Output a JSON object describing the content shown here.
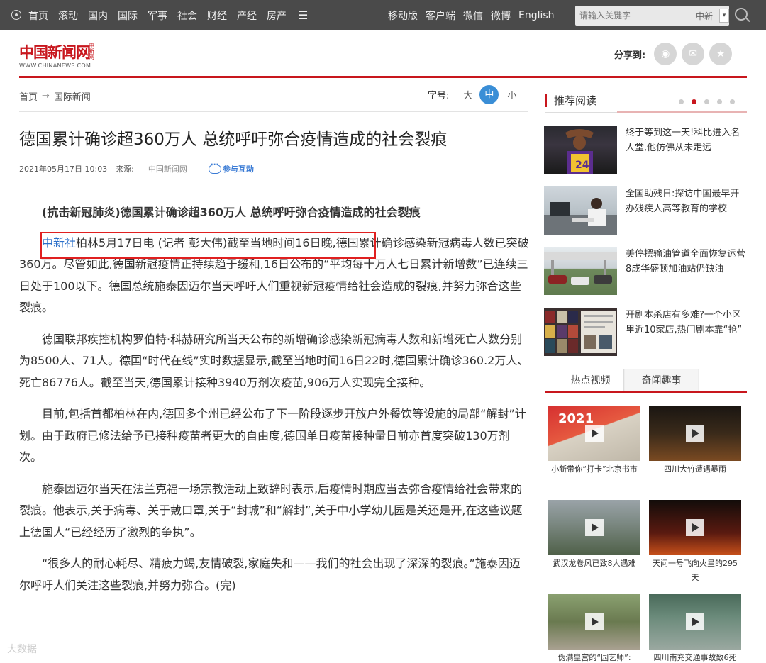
{
  "topnav": {
    "left_items": [
      "首页",
      "滚动",
      "国内",
      "国际",
      "军事",
      "社会",
      "财经",
      "产经",
      "房产"
    ],
    "menu_glyph": "☰",
    "right_items": [
      "移动版",
      "客户端",
      "微信",
      "微博",
      "English"
    ],
    "search_placeholder": "请输入关键字",
    "search_scope": "中新",
    "dropdown_glyph": "▾"
  },
  "logo": {
    "cn": "中国新闻网",
    "small": "中新网",
    "en": "WWW.CHINANEWS.COM"
  },
  "share": {
    "label": "分享到:",
    "glyphs": [
      "◉",
      "✉",
      "★"
    ]
  },
  "breadcrumb": {
    "home": "首页",
    "sep": "→",
    "section": "国际新闻"
  },
  "fontsize": {
    "label": "字号:",
    "large": "大",
    "medium": "中",
    "small": "小"
  },
  "article": {
    "title": "德国累计确诊超360万人 总统呼吁弥合疫情造成的社会裂痕",
    "date": "2021年05月17日 10:03",
    "source_label": "来源:",
    "source": "中国新闻网",
    "interact": "参与互动",
    "lead": "(抗击新冠肺炎)德国累计确诊超360万人 总统呼吁弥合疫情造成的社会裂痕",
    "p1_agency": "中新社",
    "p1_highlight": "柏林5月17日电 (记者 彭大伟)截至当地时间16日晚,",
    "p1_rest": "德国累计确诊感染新冠病毒人数已突破360万。尽管如此,德国新冠疫情正持续趋于缓和,16日公布的“平均每十万人七日累计新增数”已连续三日处于100以下。德国总统施泰因迈尔当天呼吁人们重视新冠疫情给社会造成的裂痕,并努力弥合这些裂痕。",
    "p2": "德国联邦疾控机构罗伯特·科赫研究所当天公布的新增确诊感染新冠病毒人数和新增死亡人数分别为8500人、71人。德国“时代在线”实时数据显示,截至当地时间16日22时,德国累计确诊360.2万人、死亡86776人。截至当天,德国累计接种3940万剂次疫苗,906万人实现完全接种。",
    "p3": "目前,包括首都柏林在内,德国多个州已经公布了下一阶段逐步开放户外餐饮等设施的局部“解封”计划。由于政府已修法给予已接种疫苗者更大的自由度,德国单日疫苗接种量日前亦首度突破130万剂次。",
    "p4": "施泰因迈尔当天在法兰克福一场宗教活动上致辞时表示,后疫情时期应当去弥合疫情给社会带来的裂痕。他表示,关于病毒、关于戴口罩,关于“封城”和“解封”,关于中小学幼儿园是关还是开,在这些议题上德国人“已经经历了激烈的争执”。",
    "p5": "“很多人的耐心耗尽、精疲力竭,友情破裂,家庭失和——我们的社会出现了深深的裂痕。”施泰因迈尔呼吁人们关注这些裂痕,并努力弥合。(完)"
  },
  "watermark": "大数据",
  "recommend": {
    "title": "推荐阅读",
    "items": [
      {
        "text": "终于等到这一天!科比进入名人堂,他仿佛从未走远"
      },
      {
        "text": "全国助残日:探访中国最早开办残疾人高等教育的学校"
      },
      {
        "text": "美停摆输油管道全面恢复运营 8成华盛顿加油站仍缺油"
      },
      {
        "text": "开剧本杀店有多难?一个小区里近10家店,热门剧本靠“抢”"
      }
    ]
  },
  "tabs": {
    "active": "热点视频",
    "other": "奇闻趣事"
  },
  "videos": [
    {
      "caption": "小新带你“打卡”北京书市",
      "thumb_text": "2021"
    },
    {
      "caption": "四川大竹遭遇暴雨",
      "thumb_text": ""
    },
    {
      "caption": "武汉龙卷风已致8人遇难",
      "thumb_text": ""
    },
    {
      "caption": "天问一号飞向火星的295天",
      "thumb_text": ""
    },
    {
      "caption": "伪满皇宫的“园艺师”:",
      "thumb_text": ""
    },
    {
      "caption": "四川南充交通事故致6死",
      "thumb_text": ""
    }
  ],
  "colors": {
    "brand_red": "#c8161d",
    "topbar": "#4a4a4a",
    "link_blue": "#2a6fc9",
    "highlight_box": "#e02020"
  }
}
